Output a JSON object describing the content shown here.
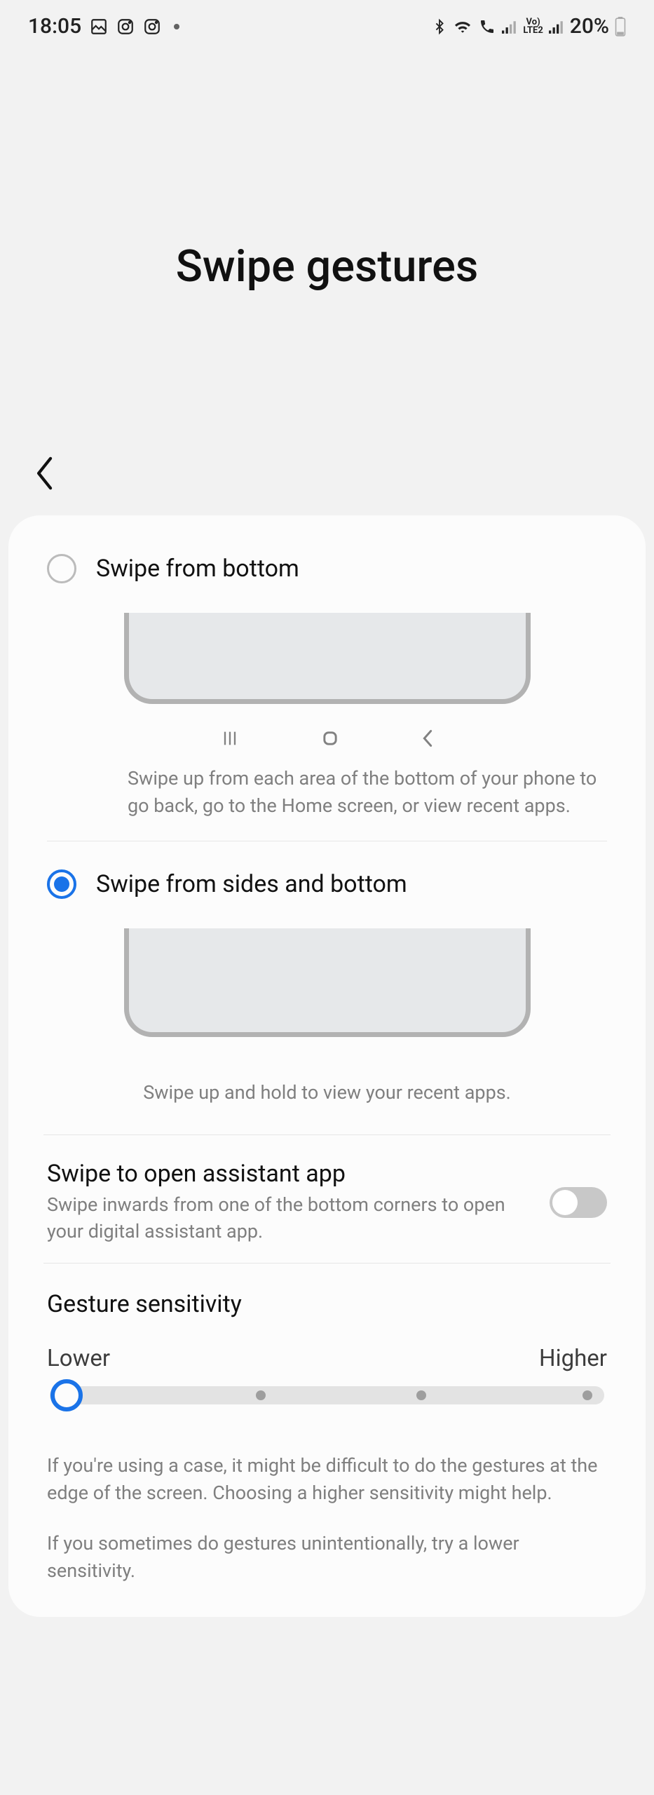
{
  "status": {
    "time": "18:05",
    "battery": "20%"
  },
  "page": {
    "title": "Swipe gestures"
  },
  "options": {
    "bottom": {
      "label": "Swipe from bottom",
      "desc": "Swipe up from each area of the bottom of your phone to go back, go to the Home screen, or view recent apps."
    },
    "sides_bottom": {
      "label": "Swipe from sides and bottom",
      "desc": "Swipe up and hold to view your recent apps."
    }
  },
  "assistant": {
    "title": "Swipe to open assistant app",
    "desc": "Swipe inwards from one of the bottom corners to open your digital assistant app."
  },
  "sensitivity": {
    "title": "Gesture sensitivity",
    "lower": "Lower",
    "higher": "Higher",
    "help1": "If you're using a case, it might be difficult to do the gestures at the edge of the screen. Choosing a higher sensitivity might help.",
    "help2": "If you sometimes do gestures unintentionally, try a lower sensitivity."
  }
}
